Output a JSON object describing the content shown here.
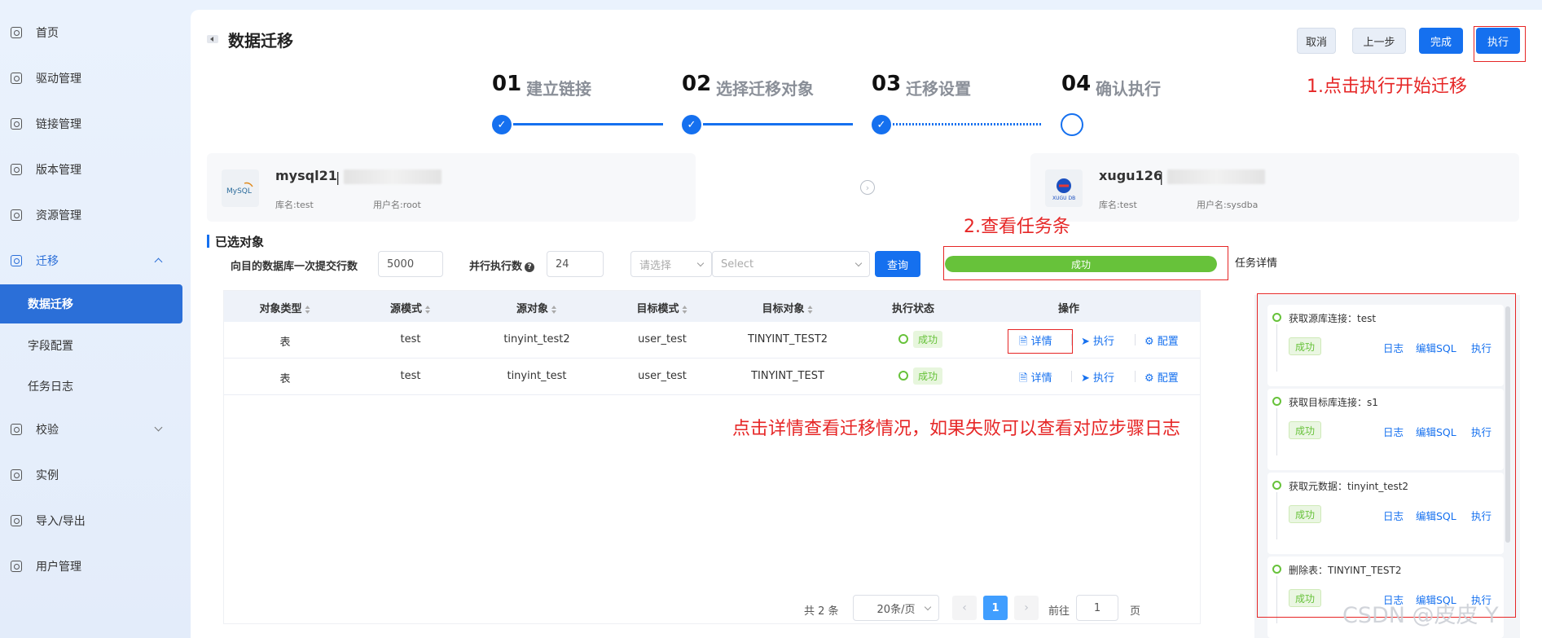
{
  "sidebar": {
    "items": [
      {
        "label": "首页",
        "icon": "home-icon"
      },
      {
        "label": "驱动管理",
        "icon": "driver-icon"
      },
      {
        "label": "链接管理",
        "icon": "link-icon"
      },
      {
        "label": "版本管理",
        "icon": "version-icon"
      },
      {
        "label": "资源管理",
        "icon": "resource-icon"
      },
      {
        "label": "迁移",
        "icon": "migrate-icon"
      },
      {
        "label": "校验",
        "icon": "verify-icon"
      },
      {
        "label": "实例",
        "icon": "instance-icon"
      },
      {
        "label": "导入/导出",
        "icon": "import-export-icon"
      },
      {
        "label": "用户管理",
        "icon": "user-icon"
      }
    ],
    "sub_items": [
      {
        "label": "数据迁移"
      },
      {
        "label": "字段配置"
      },
      {
        "label": "任务日志"
      }
    ]
  },
  "header": {
    "title": "数据迁移",
    "buttons": {
      "cancel": "取消",
      "prev": "上一步",
      "finish": "完成",
      "execute": "执行"
    }
  },
  "steps": [
    {
      "num": "01",
      "label": "建立链接"
    },
    {
      "num": "02",
      "label": "选择迁移对象"
    },
    {
      "num": "03",
      "label": "迁移设置"
    },
    {
      "num": "04",
      "label": "确认执行"
    }
  ],
  "source": {
    "name": "mysql21",
    "db": "库名:test",
    "user": "用户名:root",
    "logo_text": "MySQL"
  },
  "target": {
    "name": "xugu126",
    "db": "库名:test",
    "user": "用户名:sysdba",
    "logo_text": "XUGU DB"
  },
  "selected": {
    "title": "已选对象",
    "commit_label": "向目的数据库一次提交行数",
    "commit_value": "5000",
    "parallel_label": "并行执行数",
    "parallel_value": "24",
    "select1_placeholder": "请选择",
    "select2_placeholder": "Select",
    "query": "查询"
  },
  "progress": {
    "label": "成功",
    "percent": 100,
    "color": "#67c23a"
  },
  "task_detail_title": "任务详情",
  "table": {
    "headers": [
      "对象类型",
      "源模式",
      "源对象",
      "目标模式",
      "目标对象",
      "执行状态",
      "操作"
    ],
    "rows": [
      {
        "type": "表",
        "src_schema": "test",
        "src_obj": "tinyint_test2",
        "dst_schema": "user_test",
        "dst_obj": "TINYINT_TEST2",
        "status": "成功"
      },
      {
        "type": "表",
        "src_schema": "test",
        "src_obj": "tinyint_test",
        "dst_schema": "user_test",
        "dst_obj": "TINYINT_TEST",
        "status": "成功"
      }
    ],
    "ops": {
      "detail": "详情",
      "execute": "执行",
      "config": "配置"
    }
  },
  "pagination": {
    "total": "共 2 条",
    "page_size": "20条/页",
    "current": "1",
    "goto_label": "前往",
    "goto_value": "1",
    "page_suffix": "页"
  },
  "tasks": [
    {
      "title": "获取源库连接：test",
      "status": "成功"
    },
    {
      "title": "获取目标库连接：s1",
      "status": "成功"
    },
    {
      "title": "获取元数据：tinyint_test2",
      "status": "成功"
    },
    {
      "title": "删除表：TINYINT_TEST2",
      "status": "成功"
    }
  ],
  "task_ops": {
    "log": "日志",
    "edit_sql": "编辑SQL",
    "execute": "执行"
  },
  "annotations": {
    "a1": "1.点击执行开始迁移",
    "a2": "2.查看任务条",
    "a3": "点击详情查看迁移情况，如果失败可以查看对应步骤日志"
  },
  "watermark": "CSDN @皮皮 Y",
  "colors": {
    "accent": "#1570ef",
    "success": "#67c23a",
    "annotation": "#e62626"
  }
}
